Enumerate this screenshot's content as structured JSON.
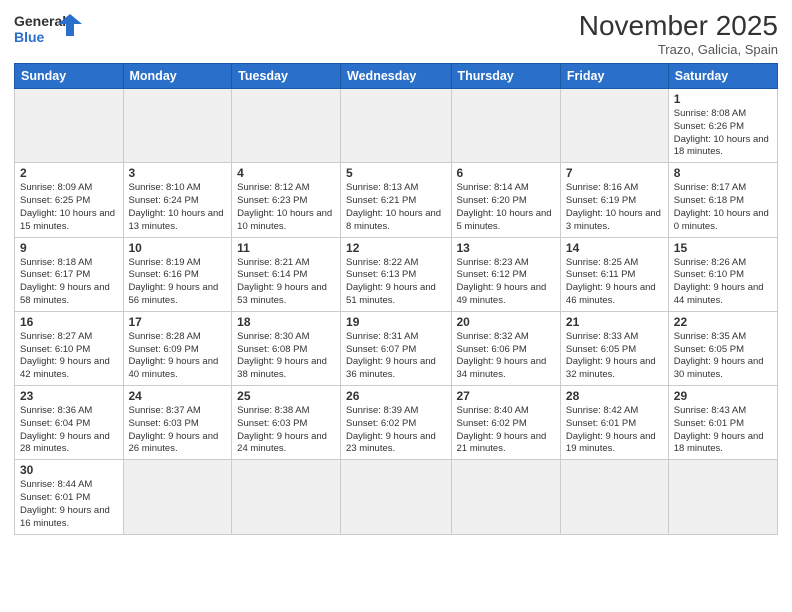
{
  "logo": {
    "text_general": "General",
    "text_blue": "Blue"
  },
  "title": "November 2025",
  "subtitle": "Trazo, Galicia, Spain",
  "weekdays": [
    "Sunday",
    "Monday",
    "Tuesday",
    "Wednesday",
    "Thursday",
    "Friday",
    "Saturday"
  ],
  "weeks": [
    [
      {
        "day": "",
        "info": ""
      },
      {
        "day": "",
        "info": ""
      },
      {
        "day": "",
        "info": ""
      },
      {
        "day": "",
        "info": ""
      },
      {
        "day": "",
        "info": ""
      },
      {
        "day": "",
        "info": ""
      },
      {
        "day": "1",
        "info": "Sunrise: 8:08 AM\nSunset: 6:26 PM\nDaylight: 10 hours and 18 minutes."
      }
    ],
    [
      {
        "day": "2",
        "info": "Sunrise: 8:09 AM\nSunset: 6:25 PM\nDaylight: 10 hours and 15 minutes."
      },
      {
        "day": "3",
        "info": "Sunrise: 8:10 AM\nSunset: 6:24 PM\nDaylight: 10 hours and 13 minutes."
      },
      {
        "day": "4",
        "info": "Sunrise: 8:12 AM\nSunset: 6:23 PM\nDaylight: 10 hours and 10 minutes."
      },
      {
        "day": "5",
        "info": "Sunrise: 8:13 AM\nSunset: 6:21 PM\nDaylight: 10 hours and 8 minutes."
      },
      {
        "day": "6",
        "info": "Sunrise: 8:14 AM\nSunset: 6:20 PM\nDaylight: 10 hours and 5 minutes."
      },
      {
        "day": "7",
        "info": "Sunrise: 8:16 AM\nSunset: 6:19 PM\nDaylight: 10 hours and 3 minutes."
      },
      {
        "day": "8",
        "info": "Sunrise: 8:17 AM\nSunset: 6:18 PM\nDaylight: 10 hours and 0 minutes."
      }
    ],
    [
      {
        "day": "9",
        "info": "Sunrise: 8:18 AM\nSunset: 6:17 PM\nDaylight: 9 hours and 58 minutes."
      },
      {
        "day": "10",
        "info": "Sunrise: 8:19 AM\nSunset: 6:16 PM\nDaylight: 9 hours and 56 minutes."
      },
      {
        "day": "11",
        "info": "Sunrise: 8:21 AM\nSunset: 6:14 PM\nDaylight: 9 hours and 53 minutes."
      },
      {
        "day": "12",
        "info": "Sunrise: 8:22 AM\nSunset: 6:13 PM\nDaylight: 9 hours and 51 minutes."
      },
      {
        "day": "13",
        "info": "Sunrise: 8:23 AM\nSunset: 6:12 PM\nDaylight: 9 hours and 49 minutes."
      },
      {
        "day": "14",
        "info": "Sunrise: 8:25 AM\nSunset: 6:11 PM\nDaylight: 9 hours and 46 minutes."
      },
      {
        "day": "15",
        "info": "Sunrise: 8:26 AM\nSunset: 6:10 PM\nDaylight: 9 hours and 44 minutes."
      }
    ],
    [
      {
        "day": "16",
        "info": "Sunrise: 8:27 AM\nSunset: 6:10 PM\nDaylight: 9 hours and 42 minutes."
      },
      {
        "day": "17",
        "info": "Sunrise: 8:28 AM\nSunset: 6:09 PM\nDaylight: 9 hours and 40 minutes."
      },
      {
        "day": "18",
        "info": "Sunrise: 8:30 AM\nSunset: 6:08 PM\nDaylight: 9 hours and 38 minutes."
      },
      {
        "day": "19",
        "info": "Sunrise: 8:31 AM\nSunset: 6:07 PM\nDaylight: 9 hours and 36 minutes."
      },
      {
        "day": "20",
        "info": "Sunrise: 8:32 AM\nSunset: 6:06 PM\nDaylight: 9 hours and 34 minutes."
      },
      {
        "day": "21",
        "info": "Sunrise: 8:33 AM\nSunset: 6:05 PM\nDaylight: 9 hours and 32 minutes."
      },
      {
        "day": "22",
        "info": "Sunrise: 8:35 AM\nSunset: 6:05 PM\nDaylight: 9 hours and 30 minutes."
      }
    ],
    [
      {
        "day": "23",
        "info": "Sunrise: 8:36 AM\nSunset: 6:04 PM\nDaylight: 9 hours and 28 minutes."
      },
      {
        "day": "24",
        "info": "Sunrise: 8:37 AM\nSunset: 6:03 PM\nDaylight: 9 hours and 26 minutes."
      },
      {
        "day": "25",
        "info": "Sunrise: 8:38 AM\nSunset: 6:03 PM\nDaylight: 9 hours and 24 minutes."
      },
      {
        "day": "26",
        "info": "Sunrise: 8:39 AM\nSunset: 6:02 PM\nDaylight: 9 hours and 23 minutes."
      },
      {
        "day": "27",
        "info": "Sunrise: 8:40 AM\nSunset: 6:02 PM\nDaylight: 9 hours and 21 minutes."
      },
      {
        "day": "28",
        "info": "Sunrise: 8:42 AM\nSunset: 6:01 PM\nDaylight: 9 hours and 19 minutes."
      },
      {
        "day": "29",
        "info": "Sunrise: 8:43 AM\nSunset: 6:01 PM\nDaylight: 9 hours and 18 minutes."
      }
    ],
    [
      {
        "day": "30",
        "info": "Sunrise: 8:44 AM\nSunset: 6:01 PM\nDaylight: 9 hours and 16 minutes."
      },
      {
        "day": "",
        "info": ""
      },
      {
        "day": "",
        "info": ""
      },
      {
        "day": "",
        "info": ""
      },
      {
        "day": "",
        "info": ""
      },
      {
        "day": "",
        "info": ""
      },
      {
        "day": "",
        "info": ""
      }
    ]
  ]
}
